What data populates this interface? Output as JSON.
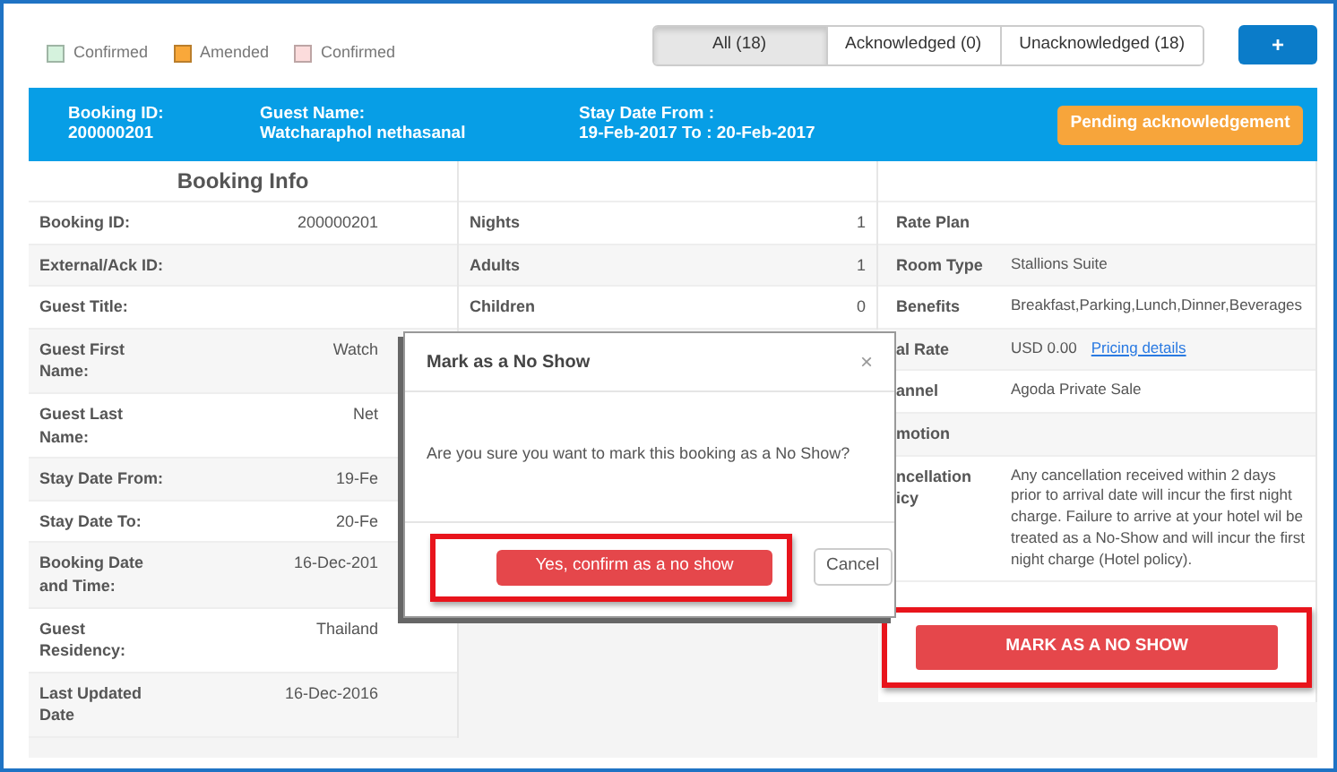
{
  "legend": [
    {
      "label": "Confirmed",
      "color": "#d5f2dd"
    },
    {
      "label": "Amended",
      "color": "#f9a83a"
    },
    {
      "label": "Confirmed",
      "color": "#fcdcdc"
    }
  ],
  "filters": [
    {
      "label": "All (18)",
      "selected": true
    },
    {
      "label": "Acknowledged (0)",
      "selected": false
    },
    {
      "label": "Unacknowledged (18)",
      "selected": false
    }
  ],
  "add_button": "+",
  "header": {
    "fields": [
      {
        "label": "Booking ID:",
        "value": "200000201"
      },
      {
        "label": "Guest Name:",
        "value": "Watcharaphol nethasanal"
      },
      {
        "label": "Stay Date From :",
        "value": "19-Feb-2017 To : 20-Feb-2017"
      }
    ],
    "status_button": "Pending acknowledgement"
  },
  "booking_info": {
    "title": "Booking Info",
    "rows": [
      {
        "label": "Booking ID:",
        "value": "200000201"
      },
      {
        "label": "External/Ack ID:"
      },
      {
        "label": "Guest Title:"
      },
      {
        "label": "Guest First\nName:",
        "value": "Watch"
      },
      {
        "label": "Guest Last\nName:",
        "value": "Net"
      },
      {
        "label": "Stay Date From:",
        "value": "19-Fe"
      },
      {
        "label": "Stay Date To:",
        "value": "20-Fe"
      },
      {
        "label": "Booking Date\nand Time:",
        "value": "16-Dec-201"
      },
      {
        "label": "Guest\nResidency:",
        "value": "Thailand"
      },
      {
        "label": "Last Updated\nDate",
        "value": "16-Dec-2016"
      }
    ]
  },
  "stay_details": {
    "rows": [
      {
        "label": "Nights",
        "value": "1"
      },
      {
        "label": "Adults",
        "value": "1"
      },
      {
        "label": "Children",
        "value": "0"
      }
    ]
  },
  "rate_details": {
    "rows": [
      {
        "label": "Rate Plan"
      },
      {
        "label": "Room Type",
        "value": "Stallions Suite"
      },
      {
        "label": "Benefits",
        "value": "Breakfast,Parking,Lunch,Dinner,Beverages"
      },
      {
        "label": "al Rate",
        "value": "USD 0.00",
        "link": "Pricing details"
      },
      {
        "label": "annel",
        "value": "Agoda Private Sale"
      },
      {
        "label": "motion"
      },
      {
        "label": "ncellation\nicy",
        "value": "Any cancellation received within 2 days prior to arrival date will incur the first night charge.  Failure to arrive at your hotel wil be treated as a No-Show and will incur the first night charge (Hotel policy)."
      }
    ]
  },
  "mark_no_show_button": "MARK AS A NO SHOW",
  "dialog": {
    "title": "Mark as a No Show",
    "close": "×",
    "message": "Are you sure you want to mark this booking as a No Show?",
    "confirm": "Yes, confirm as a no show",
    "cancel": "Cancel"
  }
}
